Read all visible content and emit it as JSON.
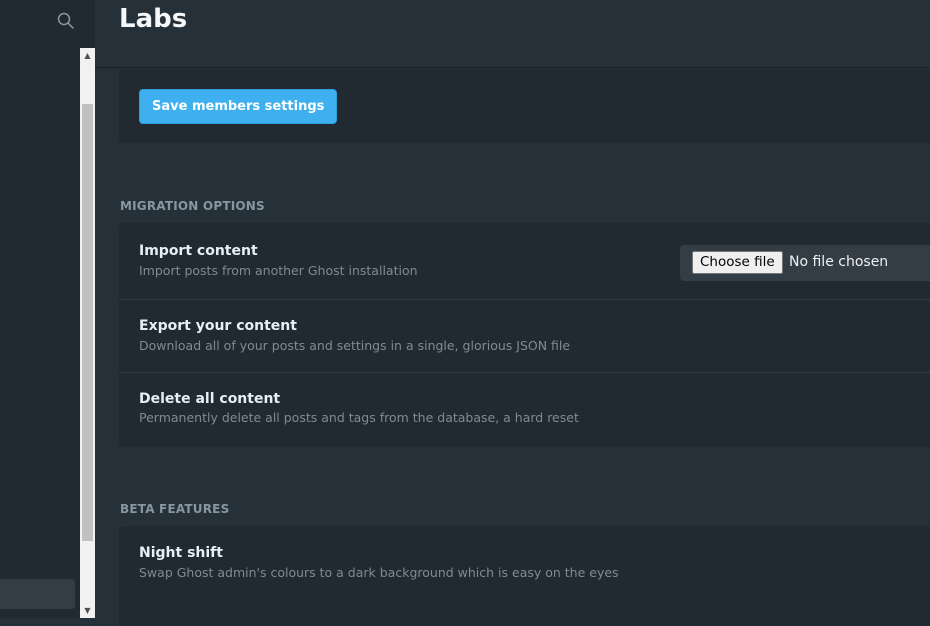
{
  "header": {
    "title": "Labs"
  },
  "members": {
    "save_label": "Save members settings"
  },
  "migration": {
    "heading": "MIGRATION OPTIONS",
    "import": {
      "title": "Import content",
      "description": "Import posts from another Ghost installation",
      "choose_file_label": "Choose file",
      "file_status": "No file chosen"
    },
    "export": {
      "title": "Export your content",
      "description": "Download all of your posts and settings in a single, glorious JSON file"
    },
    "delete": {
      "title": "Delete all content",
      "description": "Permanently delete all posts and tags from the database, a hard reset"
    }
  },
  "beta": {
    "heading": "BETA FEATURES",
    "night_shift": {
      "title": "Night shift",
      "description": "Swap Ghost admin's colours to a dark background which is easy on the eyes"
    }
  },
  "icons": {
    "sidebar_search": "search-icon"
  },
  "colors": {
    "accent": "#3eb0ef",
    "background": "#263038",
    "panel": "#212a31"
  }
}
